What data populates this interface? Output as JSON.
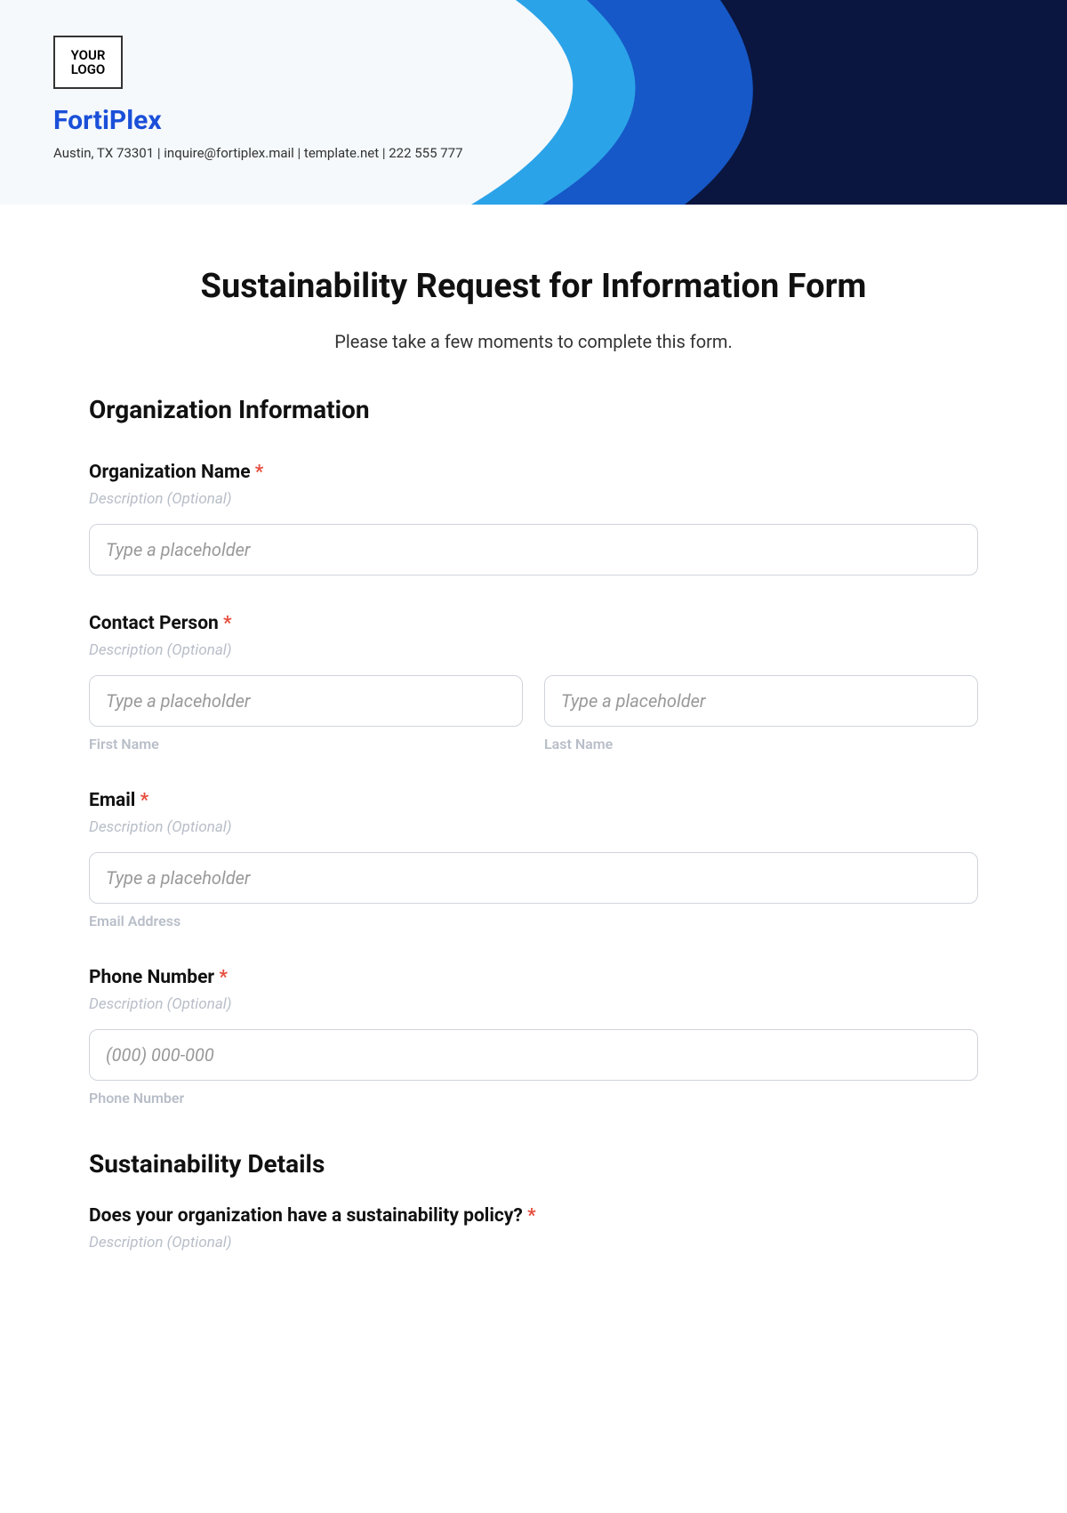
{
  "header": {
    "logo_text": "YOUR\nLOGO",
    "company_name": "FortiPlex",
    "info": "Austin, TX 73301 | inquire@fortiplex.mail | template.net | 222 555 777"
  },
  "page": {
    "title": "Sustainability Request for Information Form",
    "subtitle": "Please take a few moments to complete this form."
  },
  "section1": {
    "title": "Organization Information",
    "org_name": {
      "label": "Organization Name",
      "desc": "Description (Optional)",
      "placeholder": "Type a placeholder"
    },
    "contact": {
      "label": "Contact Person",
      "desc": "Description (Optional)",
      "first_placeholder": "Type a placeholder",
      "first_sublabel": "First Name",
      "last_placeholder": "Type a placeholder",
      "last_sublabel": "Last Name"
    },
    "email": {
      "label": "Email",
      "desc": "Description (Optional)",
      "placeholder": "Type a placeholder",
      "sublabel": "Email Address"
    },
    "phone": {
      "label": "Phone Number",
      "desc": "Description (Optional)",
      "placeholder": "(000) 000-000",
      "sublabel": "Phone Number"
    }
  },
  "section2": {
    "title": "Sustainability Details",
    "policy": {
      "label": "Does your organization have a sustainability policy?",
      "desc": "Description (Optional)"
    }
  },
  "required_mark": " *"
}
